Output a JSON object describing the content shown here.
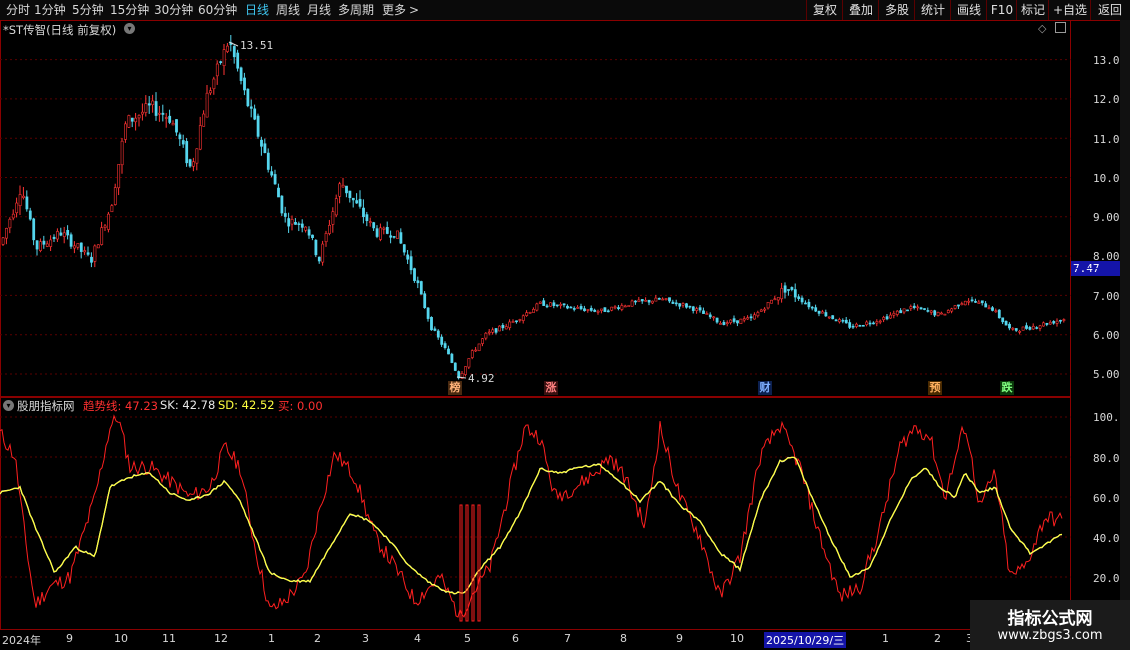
{
  "toolbar": {
    "periods": [
      {
        "label": "分时",
        "x": 6
      },
      {
        "label": "1分钟",
        "x": 34
      },
      {
        "label": "5分钟",
        "x": 72
      },
      {
        "label": "15分钟",
        "x": 110
      },
      {
        "label": "30分钟",
        "x": 154
      },
      {
        "label": "60分钟",
        "x": 198
      },
      {
        "label": "日线",
        "x": 245,
        "active": true
      },
      {
        "label": "周线",
        "x": 276
      },
      {
        "label": "月线",
        "x": 307
      },
      {
        "label": "多周期",
        "x": 338
      },
      {
        "label": "更多",
        "x": 382
      }
    ],
    "more_arrow": ">",
    "right_buttons": [
      "复权",
      "叠加",
      "多股",
      "统计",
      "画线",
      "F10",
      "标记",
      "+自选",
      "返回"
    ]
  },
  "main_chart": {
    "stock_title": "*ST传智(日线 前复权)",
    "y_ticks": [
      "13.00",
      "12.00",
      "11.00",
      "10.00",
      "9.00",
      "8.00",
      "7.00",
      "6.00",
      "5.00"
    ],
    "current_price": "7.47",
    "high_label": "13.51",
    "low_label": "4.92",
    "event_markers": [
      {
        "text": "榜",
        "color": "#ffb27a",
        "bg": "#4a2a10"
      },
      {
        "text": "涨",
        "color": "#ff8080",
        "bg": "#3a1010"
      },
      {
        "text": "财",
        "color": "#80b0ff",
        "bg": "#0c2050"
      },
      {
        "text": "预",
        "color": "#ffb060",
        "bg": "#4a2a00"
      },
      {
        "text": "跌",
        "color": "#80ff80",
        "bg": "#0a3a0a"
      }
    ],
    "colors": {
      "up": "#ff3333",
      "down": "#55d6ee"
    }
  },
  "indicator": {
    "name": "股朋指标网",
    "legend": [
      {
        "label": "趋势线: 47.23",
        "color": "#ff3030"
      },
      {
        "label": "SK: 42.78",
        "color": "#e8e8e8"
      },
      {
        "label": "SD: 42.52",
        "color": "#ffff40"
      },
      {
        "label": "买: 0.00",
        "color": "#ff3030"
      }
    ],
    "y_ticks": [
      "100.0",
      "80.00",
      "60.00",
      "40.00",
      "20.00"
    ]
  },
  "date_axis": {
    "labels": [
      "2024年",
      "9",
      "10",
      "11",
      "12",
      "1",
      "2",
      "3",
      "4",
      "5",
      "6",
      "7",
      "8",
      "9",
      "10",
      "2025/10/29/三",
      "1",
      "2",
      "3"
    ]
  },
  "watermark": {
    "line1": "指标公式网",
    "line2": "www.zbgs3.com"
  }
}
